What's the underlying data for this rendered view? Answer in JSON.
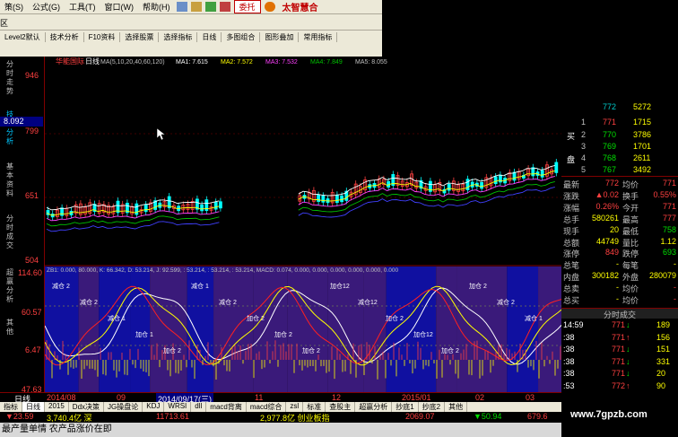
{
  "menubar": {
    "items": [
      "策(S)",
      "公式(G)",
      "工具(T)",
      "窗口(W)",
      "帮助(H)"
    ],
    "badge": "委托",
    "brand": "太智慧合"
  },
  "tabbar": {
    "left_label": "区"
  },
  "toolbar": {
    "items": [
      "Level2默认",
      "技术分析",
      "F10资料",
      "选择股票",
      "选择指标",
      "日线",
      "多图组合",
      "图形叠加",
      "常用指标"
    ]
  },
  "chart_header": {
    "stock_name": "华能国际",
    "period": "日线",
    "ma_text": "MA(5,10,20,40,60,120)",
    "ma1": "MA1: 7.615",
    "ma2": "MA2: 7.572",
    "ma3": "MA3: 7.532",
    "ma4": "MA4: 7.849",
    "ma5": "MA5: 8.055"
  },
  "price_axis": {
    "labels": [
      "946",
      "799",
      "651",
      "504"
    ],
    "cursor_value": "8.092"
  },
  "indicator_header": "ZB1: 0.000, 80.000, K: 66.342, D: 53.214, J: 92.599, : 53.214, : 53.214, : 53.214, MACD: 0.074, 0.000, 0.000, 0.000, 0.000, 0.000, 0.000",
  "indicator_axis": {
    "labels": [
      "114.60",
      "60.57",
      "6.47",
      "47.63"
    ]
  },
  "indicator_annotations": [
    "减仓 2",
    "减仓 2",
    "减仓 1",
    "加仓 1",
    "加仓 2",
    "减仓 1",
    "减仓 2",
    "加仓 2",
    "加仓 2",
    "加仓 2",
    "加仓12",
    "减仓12",
    "加仓 2",
    "加仓12",
    "加仓 2",
    "加仓 2",
    "减仓 2",
    "减仓 1"
  ],
  "left_nav": [
    "分时走势",
    "技术分析",
    "基本资料",
    "分时成交",
    "超赢分析",
    "其他"
  ],
  "orderbook": {
    "sell": [
      {
        "n": "1",
        "price": "771",
        "vol": "1715"
      },
      {
        "n": "",
        "price": "772",
        "vol": "5272"
      }
    ],
    "buy": [
      {
        "n": "1",
        "price": "771",
        "vol": "1715"
      },
      {
        "n": "2",
        "price": "770",
        "vol": "3786"
      },
      {
        "n": "3",
        "price": "769",
        "vol": "1701"
      },
      {
        "n": "4",
        "price": "768",
        "vol": "2611"
      },
      {
        "n": "5",
        "price": "767",
        "vol": "3492"
      }
    ],
    "buy_label": "买",
    "buy_label2": "盘"
  },
  "quote": [
    {
      "l1": "最新",
      "v1": "772",
      "l2": "均价",
      "v2": "771"
    },
    {
      "l1": "涨跌",
      "v1": "▲0.02",
      "l2": "换手",
      "v2": "0.55%"
    },
    {
      "l1": "涨幅",
      "v1": "0.26%",
      "l2": "今开",
      "v2": "771"
    },
    {
      "l1": "总手",
      "v1": "580261",
      "l2": "最高",
      "v2": "777"
    },
    {
      "l1": "现手",
      "v1": "20",
      "l2": "最低",
      "v2": "758"
    },
    {
      "l1": "总额",
      "v1": "44749",
      "l2": "量比",
      "v2": "1.12"
    },
    {
      "l1": "涨停",
      "v1": "849",
      "l2": "跌停",
      "v2": "693"
    },
    {
      "l1": "总笔",
      "v1": "-",
      "l2": "每笔",
      "v2": "-"
    },
    {
      "l1": "内盘",
      "v1": "300182",
      "l2": "外盘",
      "v2": "280079"
    },
    {
      "l1": "总卖",
      "v1": "-",
      "l2": "均价",
      "v2": "-"
    },
    {
      "l1": "总买",
      "v1": "-",
      "l2": "均价",
      "v2": "-"
    }
  ],
  "ticks_title": "分时成交",
  "ticks": [
    {
      "t": "14:59",
      "p": "771",
      "a": "↓",
      "v": "189"
    },
    {
      "t": ":38",
      "p": "771",
      "a": "↑",
      "v": "156"
    },
    {
      "t": ":38",
      "p": "771",
      "a": "↓",
      "v": "151"
    },
    {
      "t": ":38",
      "p": "771",
      "a": "↓",
      "v": "331"
    },
    {
      "t": ":38",
      "p": "771",
      "a": "↓",
      "v": "20"
    },
    {
      "t": ":53",
      "p": "772",
      "a": "↑",
      "v": "90"
    }
  ],
  "datestrip": {
    "period": "日线",
    "d1": "2014/08",
    "d2": "09",
    "cursor_date": "2014/09/17(三)",
    "d3": "11",
    "d4": "12",
    "d5": "2015/01",
    "d6": "02",
    "d7": "03"
  },
  "bottomtabs": [
    "指标",
    "日线",
    "2015",
    "Ddx决策",
    "JG操盘论",
    "KDJ",
    "WRSI",
    "dll",
    "macd背离",
    "macd综合",
    "zsl",
    "标准",
    "查股主",
    "超赢分析",
    "抄底1",
    "抄底2",
    "其他"
  ],
  "ticker": [
    {
      "label": "",
      "val": "▼23.59"
    },
    {
      "label": "",
      "val": "3,740.4亿 深"
    },
    {
      "label": "",
      "val": "11713.61"
    },
    {
      "label": "",
      "val": "2,977.8亿 创业板指"
    },
    {
      "label": "",
      "val": "2069.07"
    },
    {
      "label": "",
      "val": "▼50.94"
    },
    {
      "label": "",
      "val": "679.6"
    }
  ],
  "statusbar": "最产量单情 农产品涨价在即",
  "watermark": "www.7gpzb.com",
  "colors": {
    "up": "#ff4040",
    "down": "#00e000",
    "frame": "#800000",
    "ma_white": "#ffffff",
    "ma_yellow": "#ffff00",
    "ma_purple": "#ff40ff",
    "ma_green": "#00c000",
    "ma_blue": "#4040ff"
  }
}
